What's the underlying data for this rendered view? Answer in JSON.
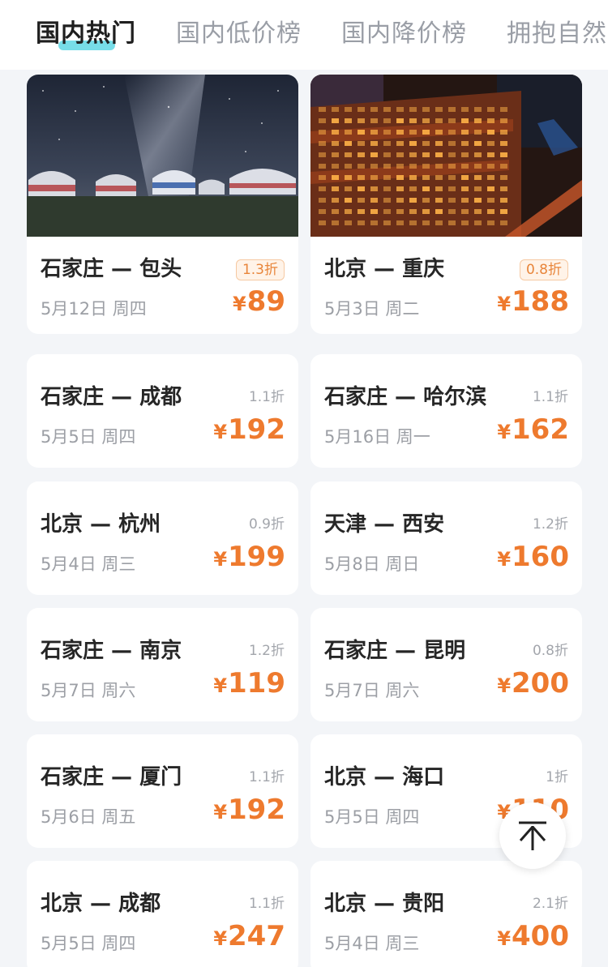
{
  "tabs": [
    {
      "label": "国内热门",
      "active": true
    },
    {
      "label": "国内低价榜",
      "active": false
    },
    {
      "label": "国内降价榜",
      "active": false
    },
    {
      "label": "拥抱自然",
      "active": false
    }
  ],
  "currency": "¥",
  "cards": [
    {
      "route": "石家庄 — 包头",
      "date": "5月12日 周四",
      "discount": "1.3折",
      "price": "89",
      "has_image": true,
      "image": "yurts-under-milky-way"
    },
    {
      "route": "北京 — 重庆",
      "date": "5月3日 周二",
      "discount": "0.8折",
      "price": "188",
      "has_image": true,
      "image": "chongqing-night-buildings"
    },
    {
      "route": "石家庄 — 成都",
      "date": "5月5日 周四",
      "discount": "1.1折",
      "price": "192"
    },
    {
      "route": "石家庄 — 哈尔滨",
      "date": "5月16日 周一",
      "discount": "1.1折",
      "price": "162"
    },
    {
      "route": "北京 — 杭州",
      "date": "5月4日 周三",
      "discount": "0.9折",
      "price": "199"
    },
    {
      "route": "天津 — 西安",
      "date": "5月8日 周日",
      "discount": "1.2折",
      "price": "160"
    },
    {
      "route": "石家庄 — 南京",
      "date": "5月7日 周六",
      "discount": "1.2折",
      "price": "119"
    },
    {
      "route": "石家庄 — 昆明",
      "date": "5月7日 周六",
      "discount": "0.8折",
      "price": "200"
    },
    {
      "route": "石家庄 — 厦门",
      "date": "5月6日 周五",
      "discount": "1.1折",
      "price": "192"
    },
    {
      "route": "北京 — 海口",
      "date": "5月5日 周四",
      "discount": "1折",
      "price": "110"
    },
    {
      "route": "北京 — 成都",
      "date": "5月5日 周四",
      "discount": "1.1折",
      "price": "247"
    },
    {
      "route": "北京 — 贵阳",
      "date": "5月4日 周三",
      "discount": "2.1折",
      "price": "400"
    }
  ],
  "back_to_top_icon": "arrow-up-to-top-icon",
  "colors": {
    "price": "#ee7a2e",
    "tab_active_underline": "#5fd7e4",
    "background": "#f3f5f8"
  }
}
